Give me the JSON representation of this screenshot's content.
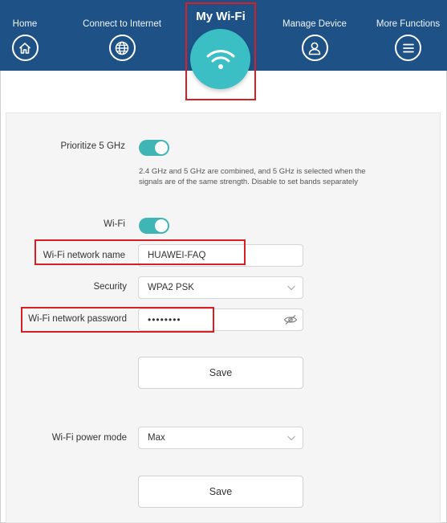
{
  "nav": {
    "home": "Home",
    "connect": "Connect to Internet",
    "active": "My Wi-Fi",
    "manage": "Manage Device",
    "more": "More Functions"
  },
  "icons": {
    "home": "home-icon",
    "connect": "globe-icon",
    "active": "wifi-icon",
    "manage": "user-icon",
    "more": "menu-icon"
  },
  "settings": {
    "prioritize_label": "Prioritize 5 GHz",
    "prioritize_on": true,
    "prioritize_hint": "2.4 GHz and 5 GHz are combined, and 5 GHz is selected when the signals are of the same strength. Disable to set bands separately",
    "wifi_label": "Wi-Fi",
    "wifi_on": true,
    "name_label": "Wi-Fi network name",
    "name_value": "HUAWEI-FAQ",
    "security_label": "Security",
    "security_value": "WPA2 PSK",
    "password_label": "Wi-Fi network password",
    "password_value": "••••••••",
    "save_label": "Save",
    "power_label": "Wi-Fi power mode",
    "power_value": "Max",
    "save2_label": "Save"
  },
  "colors": {
    "nav_bg": "#1e5287",
    "accent": "#3bbfc4",
    "toggle": "#3fb5b5",
    "highlight": "#d91f26"
  }
}
